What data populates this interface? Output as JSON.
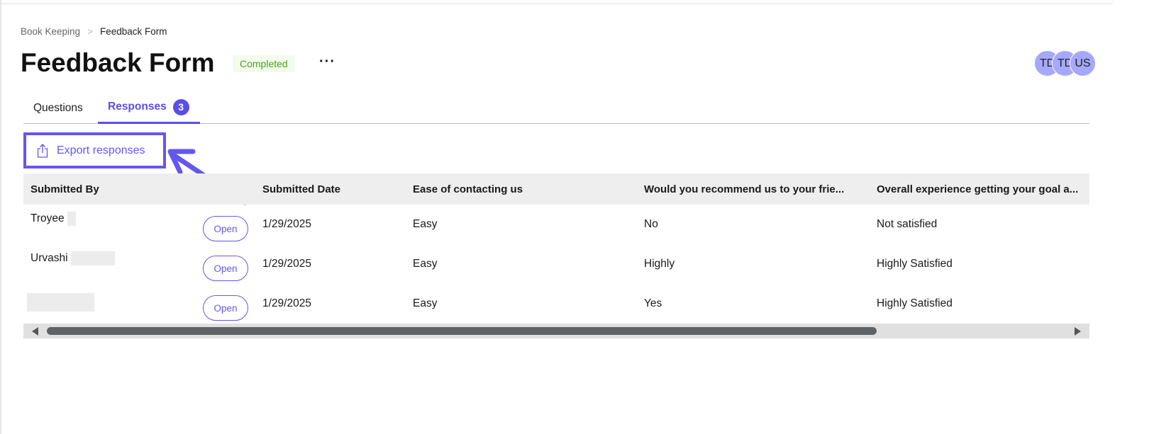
{
  "breadcrumb": {
    "parent": "Book Keeping",
    "separator": ">",
    "current": "Feedback Form"
  },
  "header": {
    "title": "Feedback Form",
    "status": "Completed",
    "more": "···"
  },
  "avatars": [
    "TD",
    "TD",
    "US"
  ],
  "tabs": {
    "questions": "Questions",
    "responses": "Responses",
    "responses_count": "3"
  },
  "export_label": "Export responses",
  "accent": "#6456f0",
  "table": {
    "columns": [
      "Submitted By",
      "Submitted Date",
      "Ease of contacting us",
      "Would you recommend us to your frie...",
      "Overall experience getting your goal a..."
    ],
    "open_label": "Open",
    "rows": [
      {
        "name": "Troyee",
        "date": "1/29/2025",
        "ease": "Easy",
        "recommend": "No",
        "overall": "Not satisfied"
      },
      {
        "name": "Urvashi",
        "date": "1/29/2025",
        "ease": "Easy",
        "recommend": "Highly",
        "overall": "Highly Satisfied"
      },
      {
        "name": "",
        "date": "1/29/2025",
        "ease": "Easy",
        "recommend": "Yes",
        "overall": "Highly Satisfied"
      }
    ]
  }
}
